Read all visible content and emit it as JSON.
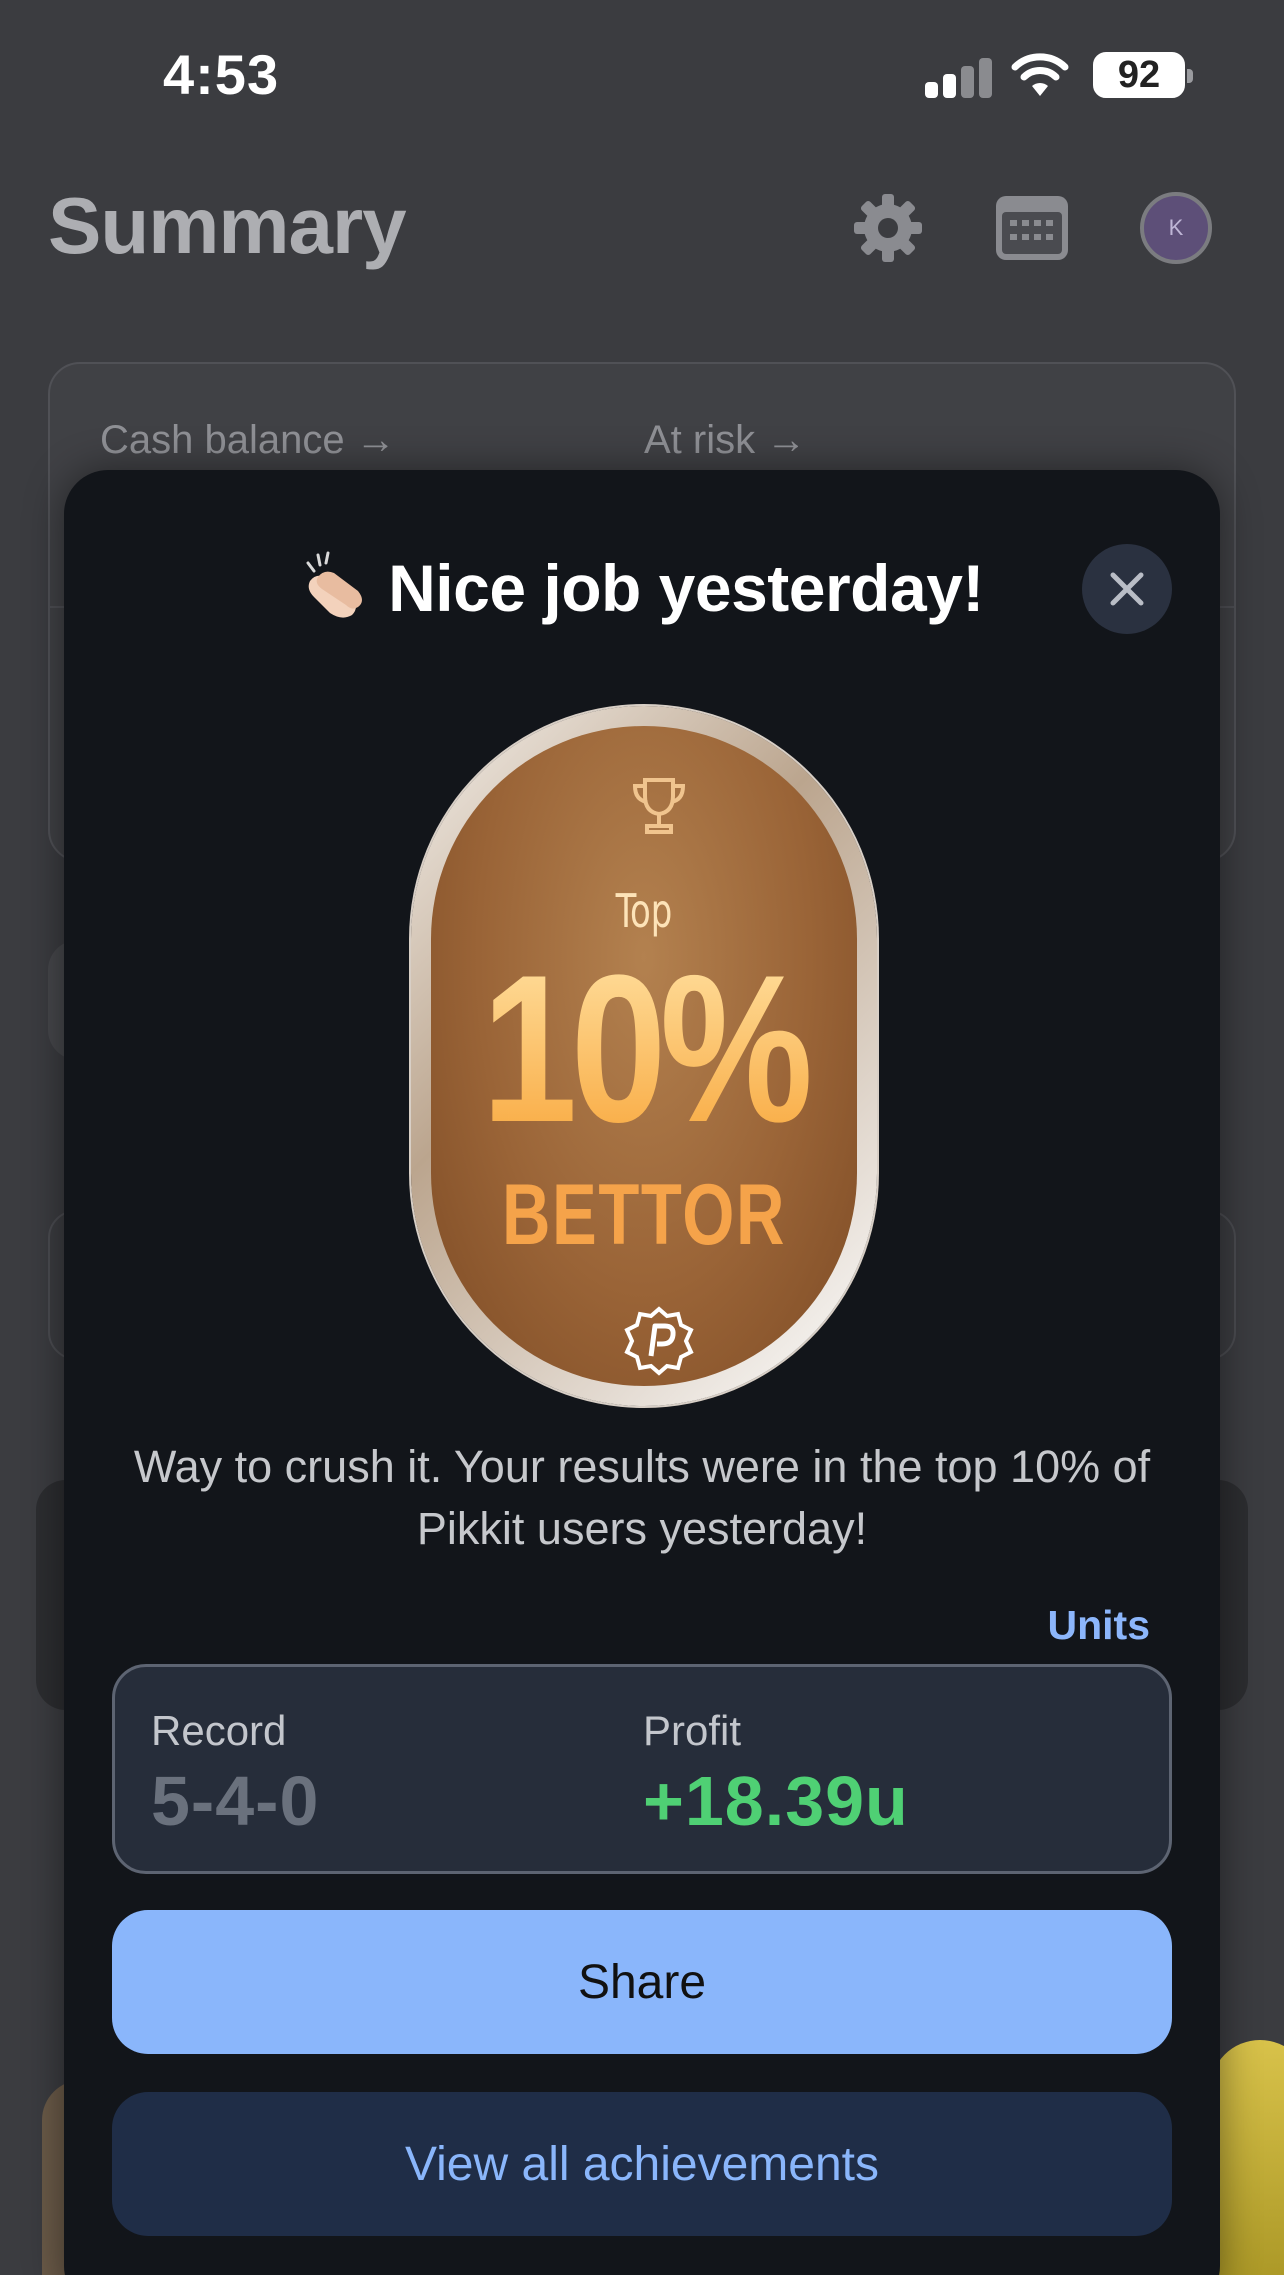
{
  "status_bar": {
    "time": "4:53",
    "battery": "92"
  },
  "header": {
    "title": "Summary",
    "avatar_initial": "K",
    "icons": [
      "gear-icon",
      "calendar-icon"
    ]
  },
  "background_card": {
    "cash_balance_label": "Cash balance →",
    "at_risk_label": "At risk →"
  },
  "modal": {
    "title": "Nice job yesterday!",
    "title_icon": "clapping-hands-icon",
    "badge": {
      "top_label": "Top",
      "percent": "10%",
      "sub_label": "BETTOR",
      "icons": [
        "trophy-icon",
        "pikkit-logo-icon"
      ]
    },
    "message": "Way to crush it. Your results were in the top 10% of Pikkit users yesterday!",
    "units_toggle": "Units",
    "stats": {
      "record_label": "Record",
      "record_value": "5-4-0",
      "profit_label": "Profit",
      "profit_value": "+18.39u"
    },
    "share_button": "Share",
    "achievements_button": "View all achievements"
  },
  "colors": {
    "accent": "#8ab6fb",
    "profit": "#4fd074",
    "modal_bg": "#12151a"
  }
}
